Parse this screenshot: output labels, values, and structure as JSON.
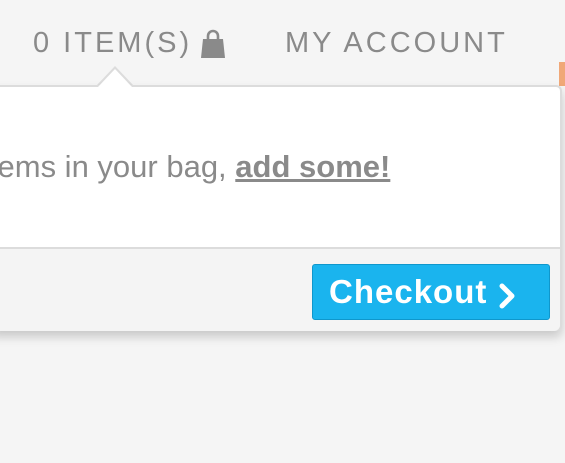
{
  "header": {
    "cart_label": "0 ITEM(S)",
    "cart_icon": "shopping-bag-icon",
    "account_label": "MY ACCOUNT"
  },
  "cart_dropdown": {
    "message_prefix": "items in your bag, ",
    "add_link_label": "add some!",
    "checkout_label": "Checkout",
    "checkout_icon": "chevron-right-icon"
  },
  "colors": {
    "checkout_button": "#1ab4ee",
    "text": "#8a8a8a",
    "accent": "#f0a878"
  }
}
